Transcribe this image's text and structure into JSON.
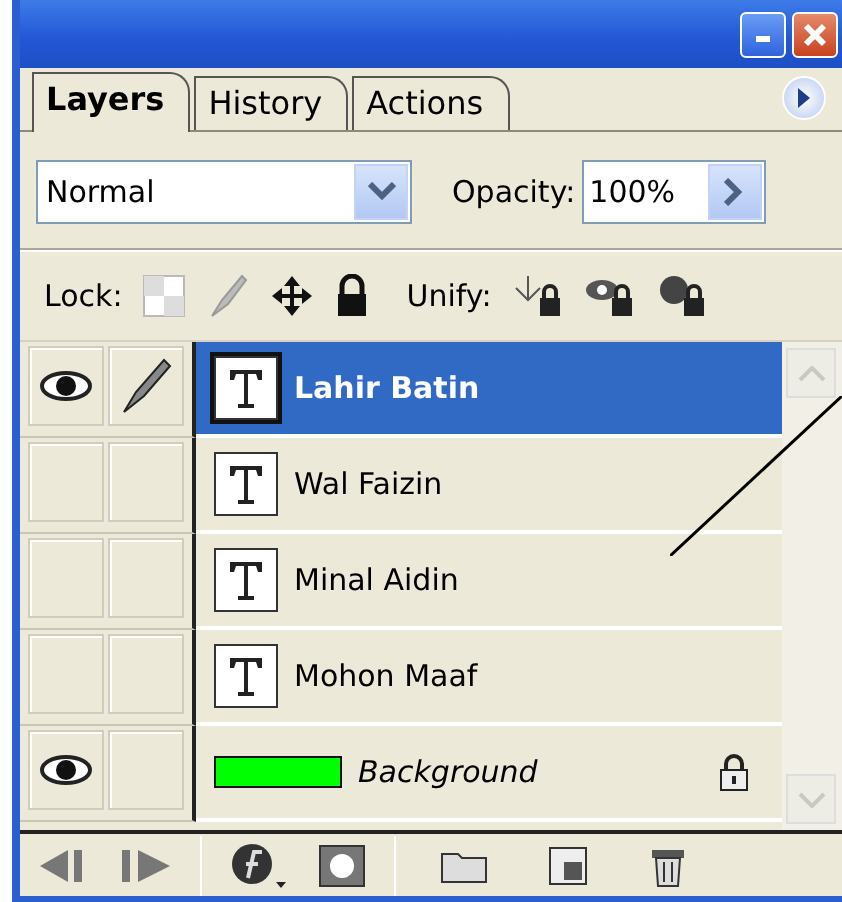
{
  "tabs": [
    {
      "label": "Layers",
      "selected": true
    },
    {
      "label": "History",
      "selected": false
    },
    {
      "label": "Actions",
      "selected": false
    }
  ],
  "blend_mode": {
    "value": "Normal"
  },
  "opacity": {
    "label": "Opacity:",
    "value": "100%"
  },
  "lock": {
    "label": "Lock:"
  },
  "unify": {
    "label": "Unify:"
  },
  "layers": [
    {
      "name": "Lahir Batin",
      "kind": "text",
      "selected": true,
      "visible": true,
      "locked": false
    },
    {
      "name": "Wal Faizin",
      "kind": "text",
      "selected": false,
      "visible": false,
      "locked": false
    },
    {
      "name": "Minal Aidin",
      "kind": "text",
      "selected": false,
      "visible": false,
      "locked": false
    },
    {
      "name": "Mohon Maaf",
      "kind": "text",
      "selected": false,
      "visible": false,
      "locked": false
    },
    {
      "name": "Background",
      "kind": "fill",
      "color": "#00ff00",
      "selected": false,
      "visible": true,
      "locked": true
    }
  ]
}
